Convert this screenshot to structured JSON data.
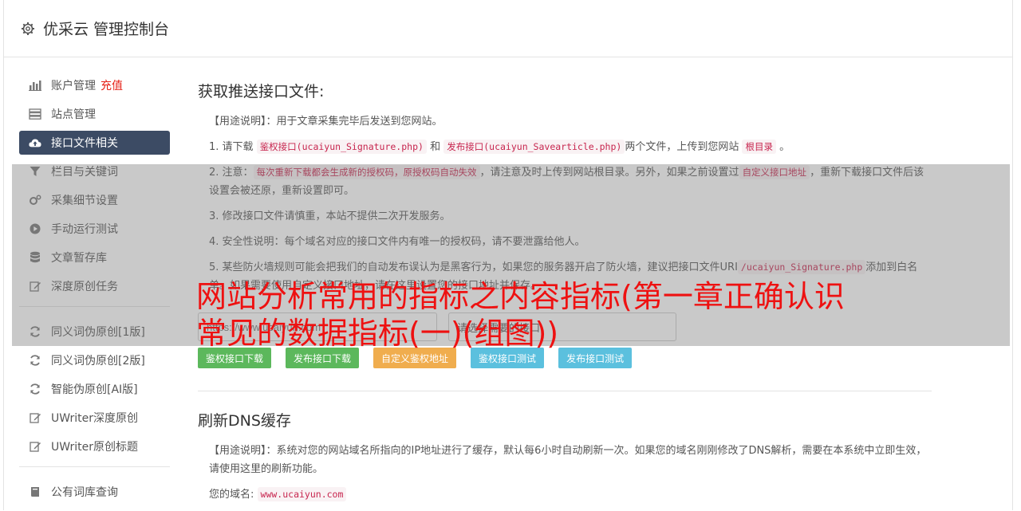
{
  "header": {
    "title": "优采云 管理控制台"
  },
  "sidebar": {
    "group1": [
      {
        "label": "账户管理",
        "badge": "充值"
      },
      {
        "label": "站点管理"
      },
      {
        "label": "接口文件相关"
      },
      {
        "label": "栏目与关键词"
      },
      {
        "label": "采集细节设置"
      },
      {
        "label": "手动运行测试"
      },
      {
        "label": "文章暂存库"
      },
      {
        "label": "深度原创任务"
      }
    ],
    "group2": [
      {
        "label": "同义词伪原创[1版]"
      },
      {
        "label": "同义词伪原创[2版]"
      },
      {
        "label": "智能伪原创[AI版]"
      },
      {
        "label": "UWriter深度原创"
      },
      {
        "label": "UWriter原创标题"
      }
    ],
    "group3": [
      {
        "label": "公有词库查询"
      }
    ]
  },
  "main": {
    "section1_title": "获取推送接口文件:",
    "usage1": "【用途说明】：用于文章采集完毕后发送到您网站。",
    "item1_prefix": "1. 请下载",
    "item1_code1": "鉴权接口(ucaiyun_Signature.php)",
    "item1_mid": "和",
    "item1_code2": "发布接口(ucaiyun_Savearticle.php)",
    "item1_mid2": "两个文件，上传到您网站",
    "item1_code3": "根目录",
    "item1_end": "。",
    "item2_prefix": "2. 注意：",
    "item2_code1": "每次重新下载都会生成新的授权码，原授权码自动失效",
    "item2_mid": "，请注意及时上传到网站根目录。另外，如果之前设置过",
    "item2_code2": "自定义接口地址",
    "item2_end": "，重新下载接口文件后该设置会被还原，重新设置即可。",
    "item3": "3. 修改接口文件请慎重，本站不提供二次开发服务。",
    "item4": "4. 安全性说明：每个域名对应的接口文件内有唯一的授权码，请不要泄露给他人。",
    "item5_prefix": "5. 某些防火墙规则可能会把我们的自动发布误认为是黑客行为，如果您的服务器开启了防火墙，建议把接口文件URI",
    "item5_code": "/ucaiyun_Signature.php",
    "item5_end": "添加到白名单。如果需要使用自定义接口地址，请在这里设置您的接口地址并保存。",
    "url_placeholder": "https://www.ucaiyun.com",
    "select_value": "请选择需要的接口",
    "buttons": [
      "鉴权接口下载",
      "发布接口下载",
      "自定义鉴权地址",
      "鉴权接口测试",
      "发布接口测试"
    ],
    "section2_title": "刷新DNS缓存",
    "usage2": "【用途说明】：系统对您的网站域名所指向的IP地址进行了缓存，默认每6小时自动刷新一次。如果您的域名刚刚修改了DNS解析，需要在本系统中立即生效，请使用这里的刷新功能。",
    "domain_label": "您的域名:",
    "domain_value": "www.ucaiyun.com"
  },
  "overlay": {
    "headline": "网站分析常用的指标之内容指标(第一章正确认识常见的数据指标(一)(组图))"
  },
  "colors": {
    "active_nav": "#3c4b64",
    "headline": "#ee1111",
    "code": "#c7254e"
  }
}
